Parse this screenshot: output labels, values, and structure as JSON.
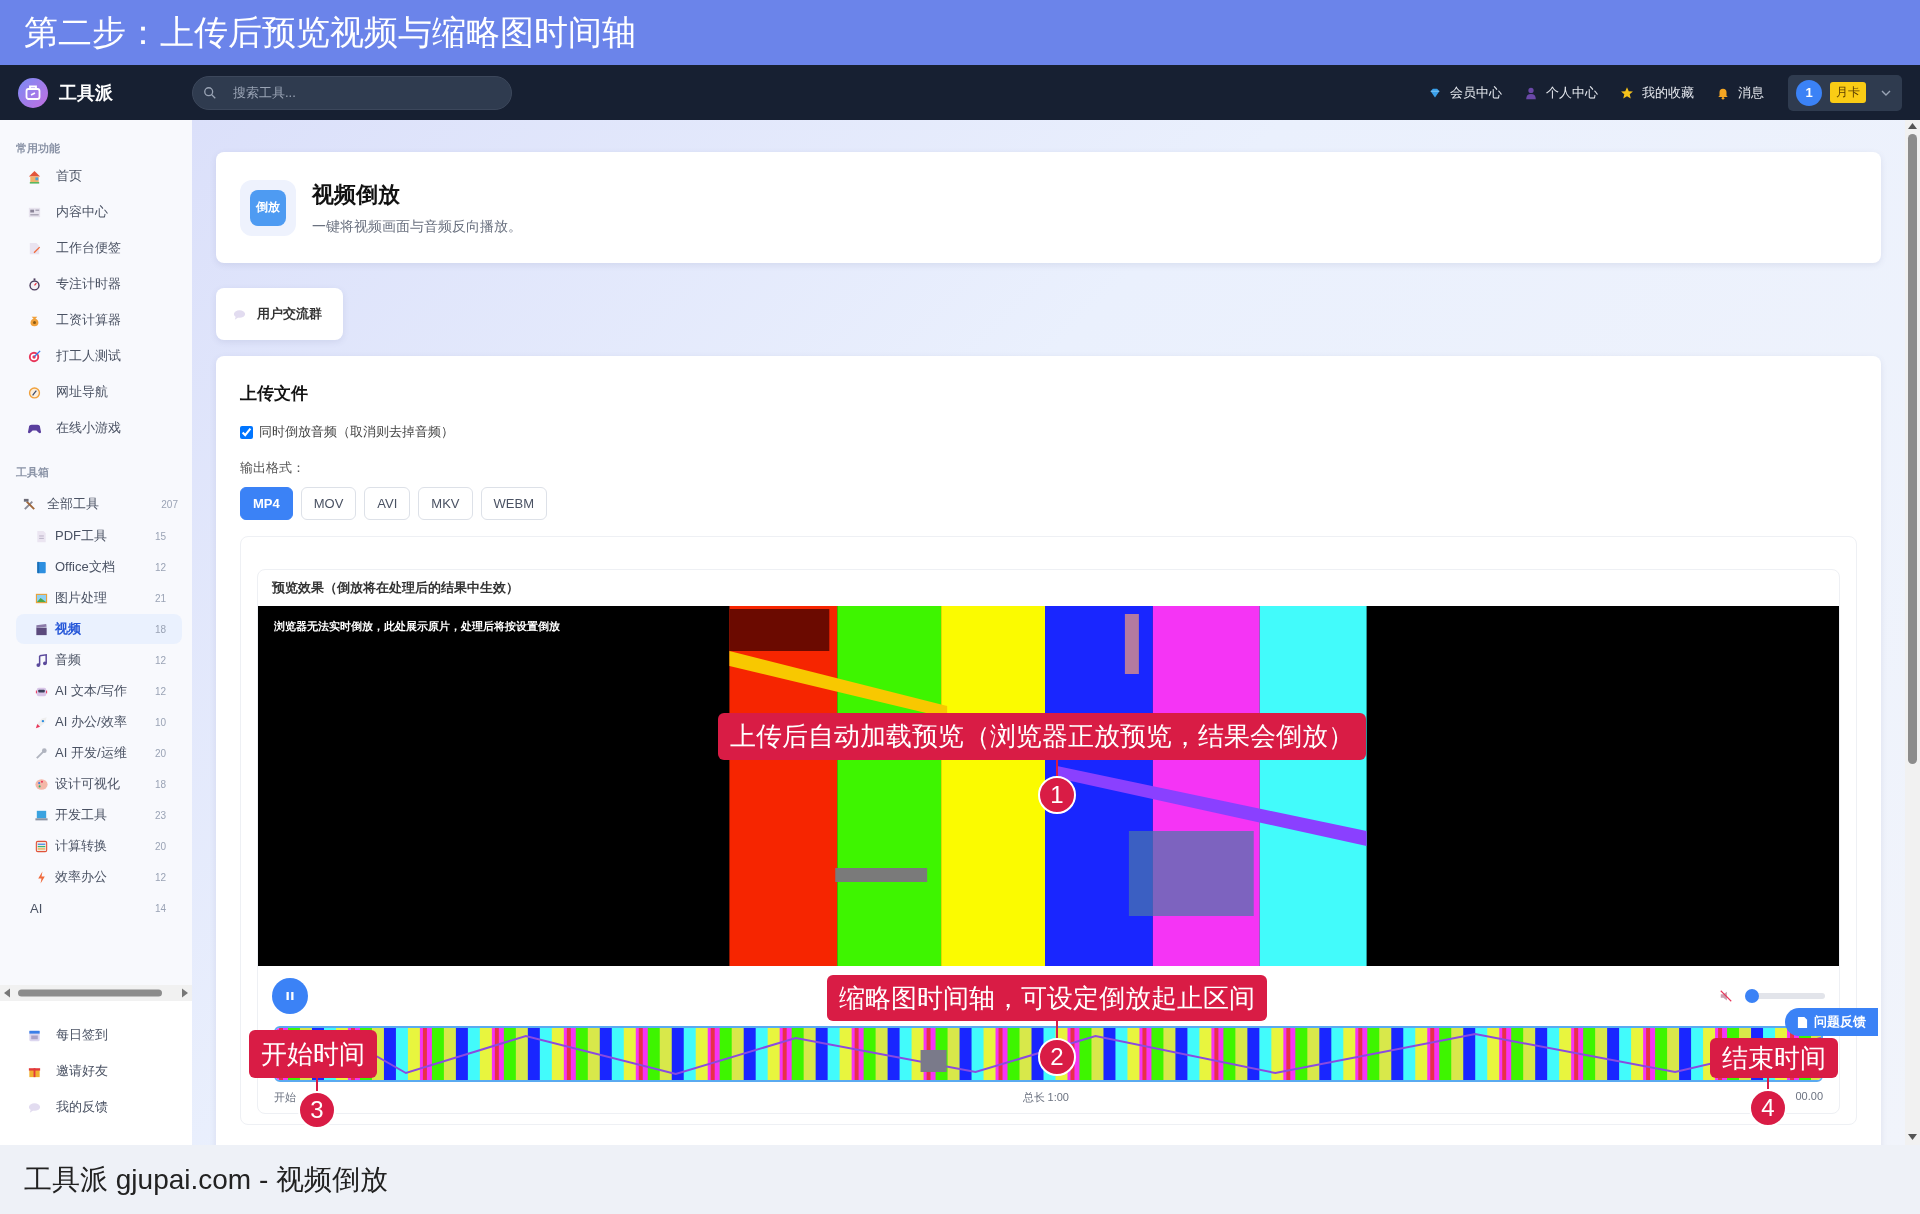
{
  "banner": {
    "title": "第二步：上传后预览视频与缩略图时间轴"
  },
  "navbar": {
    "brand": "工具派",
    "search": {
      "placeholder": "搜索工具..."
    },
    "links": [
      {
        "label": "会员中心"
      },
      {
        "label": "个人中心"
      },
      {
        "label": "我的收藏"
      },
      {
        "label": "消息"
      }
    ],
    "user": {
      "avatar": "1",
      "badge": "月卡"
    }
  },
  "sidebar": {
    "sections": [
      {
        "heading": "常用功能",
        "items": [
          {
            "label": "首页",
            "selected": false
          },
          {
            "label": "内容中心",
            "selected": false
          },
          {
            "label": "工作台便签",
            "selected": false
          },
          {
            "label": "专注计时器",
            "selected": false
          },
          {
            "label": "工资计算器",
            "selected": false
          },
          {
            "label": "打工人测试",
            "selected": false
          },
          {
            "label": "网址导航",
            "selected": false
          },
          {
            "label": "在线小游戏",
            "selected": false
          }
        ]
      },
      {
        "heading": "工具箱",
        "items": [
          {
            "label": "全部工具",
            "count": "207",
            "selected": false,
            "children": [
              {
                "label": "PDF工具",
                "count": "15",
                "selected": false
              },
              {
                "label": "Office文档",
                "count": "12",
                "selected": false
              },
              {
                "label": "图片处理",
                "count": "21",
                "selected": false
              },
              {
                "label": "视频",
                "count": "18",
                "selected": true
              },
              {
                "label": "音频",
                "count": "12",
                "selected": false
              },
              {
                "label": "AI 文本/写作",
                "count": "12",
                "selected": false
              },
              {
                "label": "AI 办公/效率",
                "count": "10",
                "selected": false
              },
              {
                "label": "AI 开发/运维",
                "count": "20",
                "selected": false
              },
              {
                "label": "设计可视化",
                "count": "18",
                "selected": false
              },
              {
                "label": "开发工具",
                "count": "23",
                "selected": false
              },
              {
                "label": "计算转换",
                "count": "20",
                "selected": false
              },
              {
                "label": "效率办公",
                "count": "12",
                "selected": false
              },
              {
                "label": "AI",
                "count": "14",
                "selected": false
              }
            ]
          }
        ]
      }
    ],
    "footer_items": [
      {
        "label": "每日签到"
      },
      {
        "label": "邀请好友"
      },
      {
        "label": "我的反馈"
      }
    ]
  },
  "tool": {
    "icon_text": "倒放",
    "title": "视频倒放",
    "subtitle": "一键将视频画面与音频反向播放。"
  },
  "group_button": {
    "label": "用户交流群"
  },
  "upload": {
    "title": "上传文件",
    "reverse_audio": {
      "label": "同时倒放音频（取消则去掉音频）",
      "checked": true
    },
    "format_label": "输出格式：",
    "formats": [
      {
        "label": "MP4",
        "selected": true
      },
      {
        "label": "MOV",
        "selected": false
      },
      {
        "label": "AVI",
        "selected": false
      },
      {
        "label": "MKV",
        "selected": false
      },
      {
        "label": "WEBM",
        "selected": false
      }
    ],
    "preview": {
      "title": "预览效果（倒放将在处理后的结果中生效）",
      "notice": "浏览器无法实时倒放，此处展示原片，处理后将按设置倒放",
      "playing": true,
      "muted": true,
      "volume": {
        "level": 0
      },
      "timeline": {
        "start_label": "开始",
        "total_label": "总长 1:00",
        "end_label": "00.00"
      }
    }
  },
  "feedback_button": {
    "label": "问题反馈"
  },
  "annotations": [
    {
      "number": "1",
      "text": "上传后自动加载预览（浏览器正放预览，结果会倒放）"
    },
    {
      "number": "2",
      "text": "缩略图时间轴，可设定倒放起止区间"
    },
    {
      "number": "3",
      "text": "开始时间"
    },
    {
      "number": "4",
      "text": "结束时间"
    }
  ],
  "caption": "工具派 gjupai.com - 视频倒放"
}
